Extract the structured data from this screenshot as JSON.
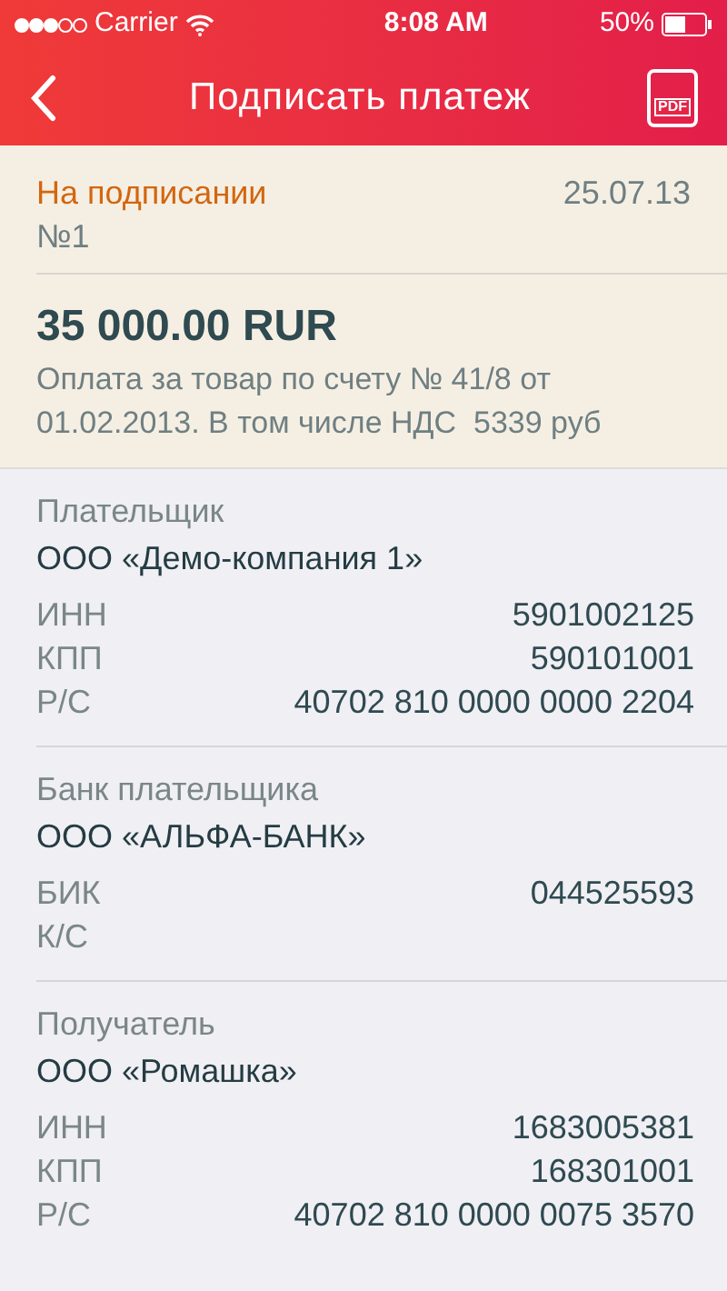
{
  "status_bar": {
    "carrier": "Carrier",
    "time": "8:08 AM",
    "battery": "50%"
  },
  "nav": {
    "title": "Подписать платеж",
    "pdf_label": "PDF"
  },
  "document": {
    "status": "На подписании",
    "date": "25.07.13",
    "number": "№1",
    "amount": "35 000.00 RUR",
    "purpose": "Оплата за товар по счету № 41/8 от 01.02.2013. В том числе НДС  5339 руб"
  },
  "sections": [
    {
      "title": "Плательщик",
      "name": "ООО «Демо-компания 1»",
      "fields": [
        {
          "label": "ИНН",
          "value": "5901002125"
        },
        {
          "label": "КПП",
          "value": "590101001"
        },
        {
          "label": "Р/С",
          "value": "40702 810 0000 0000 2204"
        }
      ]
    },
    {
      "title": "Банк плательщика",
      "name": "ООО «АЛЬФА-БАНК»",
      "fields": [
        {
          "label": "БИК",
          "value": "044525593"
        },
        {
          "label": "К/С"
        }
      ]
    },
    {
      "title": "Получатель",
      "name": "ООО «Ромашка»",
      "fields": [
        {
          "label": "ИНН",
          "value": "1683005381"
        },
        {
          "label": "КПП",
          "value": "168301001"
        },
        {
          "label": "Р/С",
          "value": "40702 810 0000 0075 3570"
        }
      ]
    }
  ]
}
